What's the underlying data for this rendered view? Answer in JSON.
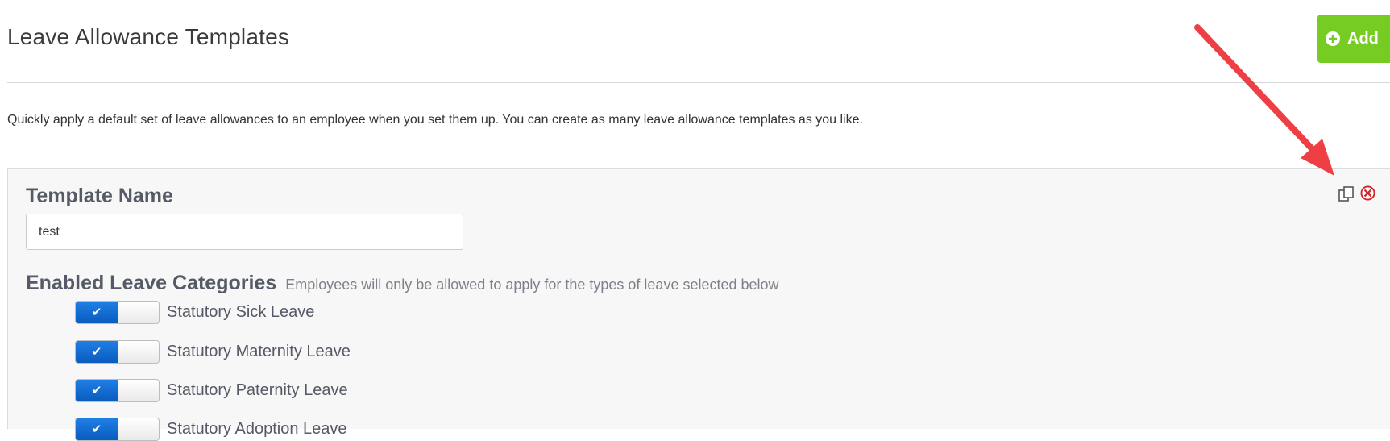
{
  "header": {
    "title": "Leave Allowance Templates",
    "add_label": "Add"
  },
  "intro_text": "Quickly apply a default set of leave allowances to an employee when you set them up. You can create as many leave allowance templates as you like.",
  "template": {
    "name_label": "Template Name",
    "name_value": "test",
    "categories_label": "Enabled Leave Categories",
    "categories_hint": "Employees will only be allowed to apply for the types of leave selected below",
    "leave_categories": [
      {
        "label": "Statutory Sick Leave",
        "enabled": true
      },
      {
        "label": "Statutory Maternity Leave",
        "enabled": true
      },
      {
        "label": "Statutory Paternity Leave",
        "enabled": true
      },
      {
        "label": "Statutory Adoption Leave",
        "enabled": true
      }
    ]
  },
  "icons": {
    "add": "plus-circle-icon",
    "copy": "copy-icon",
    "delete": "delete-circle-icon",
    "toggle_check": "check-icon"
  },
  "colors": {
    "add_button": "#77cc23",
    "toggle_on": "#0a5bbd",
    "delete_icon": "#d0272d",
    "annotation_arrow": "#ee3f45"
  }
}
